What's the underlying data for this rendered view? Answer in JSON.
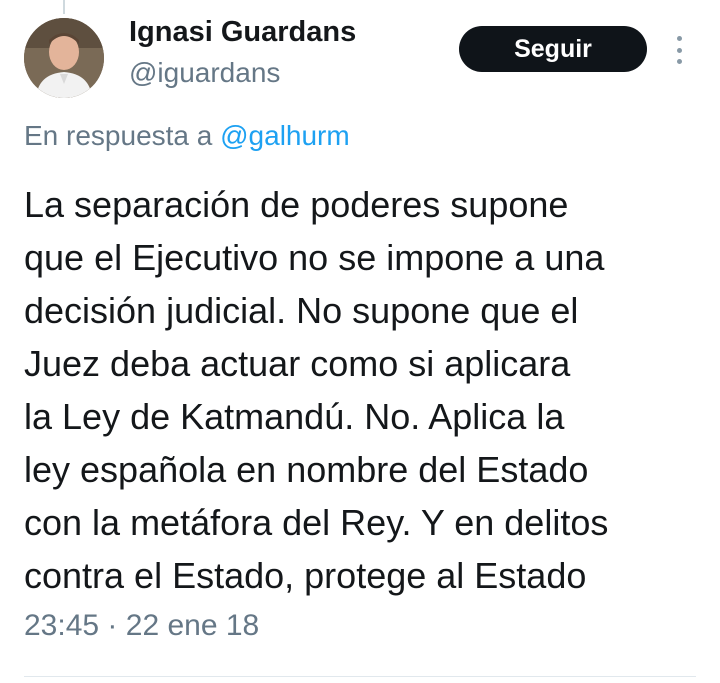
{
  "author": {
    "name": "Ignasi Guardans",
    "handle": "@iguardans"
  },
  "follow_button": {
    "label": "Seguir"
  },
  "reply": {
    "prefix": "En respuesta a",
    "mention": "@galhurm"
  },
  "tweet": {
    "lines": [
      "La separación de poderes supone",
      "que el Ejecutivo no se impone a una",
      "decisión judicial. No supone que el",
      "Juez deba actuar como si aplicara",
      "la Ley de Katmandú. No. Aplica la",
      "ley española en nombre del Estado",
      "con la metáfora del Rey. Y en delitos",
      "contra el Estado, protege al Estado"
    ]
  },
  "meta": {
    "time": "23:45",
    "separator": "·",
    "date": "22 ene 18"
  },
  "icons": {
    "more": "more-vertical-icon",
    "avatar": "avatar-photo"
  },
  "colors": {
    "text": "#14171a",
    "secondary": "#657786",
    "link": "#1da1f2",
    "button_bg": "#0f1419",
    "button_text": "#ffffff"
  }
}
